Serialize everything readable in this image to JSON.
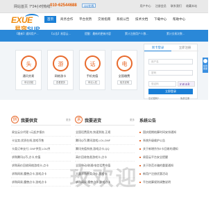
{
  "topbar": {
    "home": "网站首页",
    "hotline": "7*24小时热线：",
    "phone": "010-62544688",
    "qq": "QQ在线",
    "links": [
      "用户中心",
      "注册会员",
      "联系我们",
      "收藏本站"
    ]
  },
  "logo": {
    "line1": "EXUE",
    "line2a": "易容",
    "line2b": "SUP"
  },
  "nav": {
    "items": [
      "首页",
      "商务合作",
      "平台优势",
      "交易指南",
      "系统公告",
      "技术文档",
      "下载中心",
      "帮助中心"
    ]
  },
  "banner": {
    "items": [
      "【最新】通知用户...",
      "【公告】易容云...",
      "提醒：最新的更新内容",
      "累计注册用户人数...",
      "累计交易次数..."
    ]
  },
  "services": [
    {
      "icon": "头",
      "title": "通讯交易",
      "btn": "申请流程"
    },
    {
      "icon": "游",
      "title": "网络游卡",
      "btn": "查看更多"
    },
    {
      "icon": "话",
      "title": "手机充值",
      "btn": "申请入驻"
    },
    {
      "icon": "电",
      "title": "全国缴费",
      "btn": "相关说明"
    }
  ],
  "login": {
    "tab_member": "易卡登录",
    "tab_fast": "立即注册",
    "username_placeholder": "用户名",
    "password_placeholder": "密码",
    "code_placeholder": "验证码",
    "captcha_text": "xwak",
    "login_btn": "立即登录",
    "forgot": "忘记密码?",
    "register": "免费注册"
  },
  "side_float": {
    "text": "在线客服"
  },
  "col_sell": {
    "badge": "供",
    "title": "我要供货",
    "more": "更多",
    "items": [
      "易宝云分代理 1元起步报价",
      "卡宝卖,优质在线,游戏币售",
      "卡类订单支付, DNF供货,LOL供",
      "求购腾讯Q币,点卡,充值",
      "求购高价回收网络游戏卡,点卡",
      "求购网易,魔兽点卡,游戏点卡",
      "求购网易,魔兽点卡,游戏点卡"
    ]
  },
  "col_buy": {
    "badge": "求",
    "title": "我要进货",
    "more": "更多",
    "items": [
      "全国话费直充,快速到账,正规",
      "腾讯Q币,腾讯游戏,LOL,DNF",
      "腾讯充值系统,游戏点卡,QQ",
      "高价回收各类游戏卡,点卡",
      "全国移动/联通/电信话费充值",
      "大量求购各类点卡,游戏卡",
      "求购网易,魔兽点卡,游戏点卡"
    ]
  },
  "notices": {
    "title": "系统公告",
    "items": [
      "国庆假期结算时间安排通知",
      "系统升级维护公告",
      "关于新增京东E卡回收的通知",
      "易容云平台安全提醒",
      "关于防范诈骗的重要通知",
      "新用户注册优惠活动",
      "平台结算规则调整说明"
    ]
  },
  "watermark": "玫欢迎"
}
